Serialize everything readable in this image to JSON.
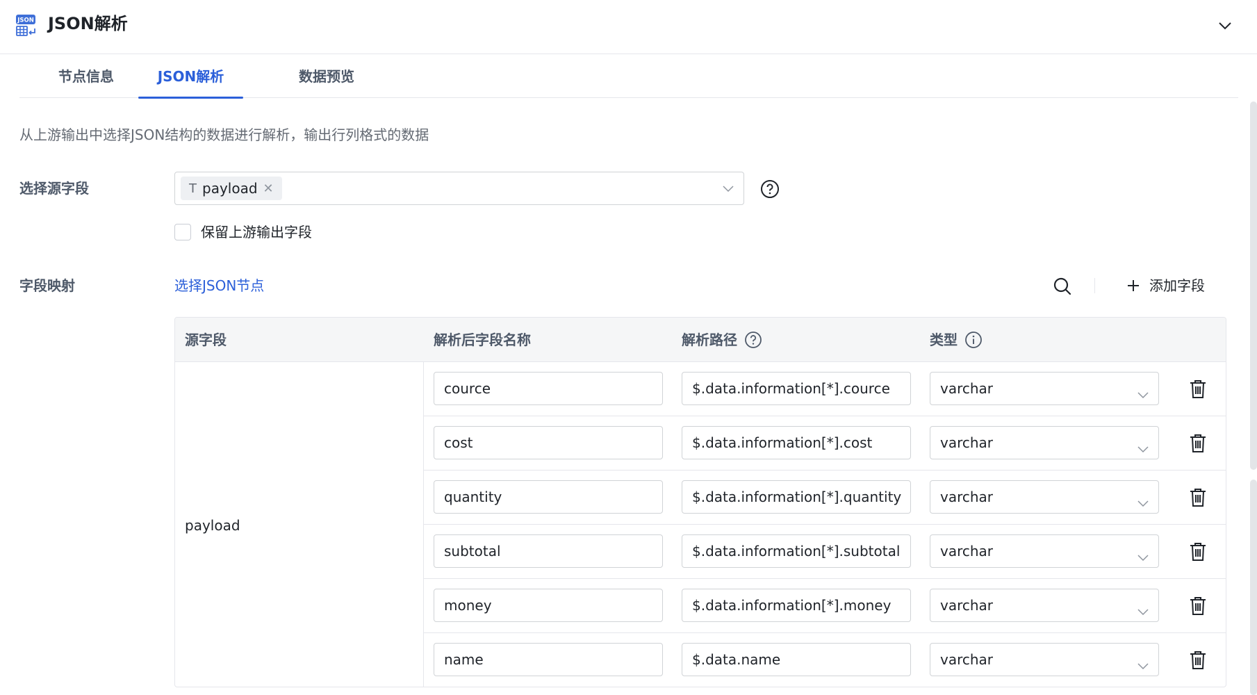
{
  "header": {
    "title": "JSON解析",
    "icon_text": "JSON",
    "icon": "json-table-icon",
    "collapse_icon": "chevron-down-icon"
  },
  "tabs": [
    {
      "label": "节点信息",
      "active": false
    },
    {
      "label": "JSON解析",
      "active": true
    },
    {
      "label": "数据预览",
      "active": false
    }
  ],
  "description": "从上游输出中选择JSON结构的数据进行解析，输出行列格式的数据",
  "source_field": {
    "label": "选择源字段",
    "selected_tag": "payload",
    "tag_type_glyph": "T",
    "help_icon": "question-circle-icon"
  },
  "keep_upstream": {
    "label": "保留上游输出字段",
    "checked": false
  },
  "mapping": {
    "label": "字段映射",
    "select_json_node": "选择JSON节点",
    "add_field": "添加字段",
    "search_icon": "search-icon",
    "add_icon": "plus-icon"
  },
  "table": {
    "headers": {
      "source": "源字段",
      "parsed_name": "解析后字段名称",
      "path": "解析路径",
      "type": "类型"
    },
    "source_value": "payload",
    "rows": [
      {
        "name": "cource",
        "path": "$.data.information[*].cource",
        "type": "varchar"
      },
      {
        "name": "cost",
        "path": "$.data.information[*].cost",
        "type": "varchar"
      },
      {
        "name": "quantity",
        "path": "$.data.information[*].quantity",
        "type": "varchar"
      },
      {
        "name": "subtotal",
        "path": "$.data.information[*].subtotal",
        "type": "varchar"
      },
      {
        "name": "money",
        "path": "$.data.information[*].money",
        "type": "varchar"
      },
      {
        "name": "name",
        "path": "$.data.name",
        "type": "varchar"
      }
    ]
  },
  "colors": {
    "accent": "#2b5fd9",
    "border": "#d0d3d6",
    "header_bg": "#f5f6f7"
  }
}
